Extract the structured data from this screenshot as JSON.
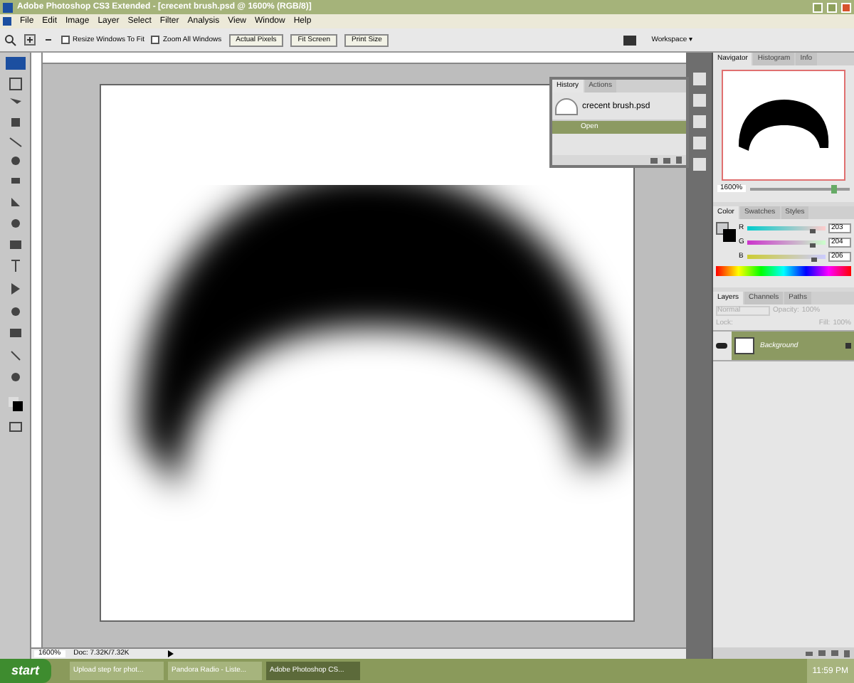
{
  "window": {
    "title": "Adobe Photoshop CS3 Extended - [crecent brush.psd @ 1600% (RGB/8)]"
  },
  "menu": [
    "File",
    "Edit",
    "Image",
    "Layer",
    "Select",
    "Filter",
    "Analysis",
    "View",
    "Window",
    "Help"
  ],
  "options_bar": {
    "checkboxes": [
      {
        "label": "Resize Windows To Fit",
        "checked": false
      },
      {
        "label": "Zoom All Windows",
        "checked": false
      }
    ],
    "buttons": [
      "Actual Pixels",
      "Fit Screen",
      "Print Size"
    ],
    "workspace": "Workspace ▾"
  },
  "history": {
    "tabs": [
      {
        "label": "History",
        "selected": true
      },
      {
        "label": "Actions",
        "selected": false
      }
    ],
    "snapshot": "crecent brush.psd",
    "items": [
      {
        "label": "Open",
        "selected": true
      }
    ]
  },
  "navigator": {
    "tabs": [
      {
        "label": "Navigator",
        "selected": true
      },
      {
        "label": "Histogram",
        "selected": false
      },
      {
        "label": "Info",
        "selected": false
      }
    ],
    "zoom": "1600%",
    "zoom_slider": {
      "level": 0.85
    }
  },
  "color": {
    "tabs": [
      {
        "label": "Color",
        "selected": true
      },
      {
        "label": "Swatches",
        "selected": false
      },
      {
        "label": "Styles",
        "selected": false
      }
    ],
    "channels": [
      {
        "name": "R",
        "level": 0.8,
        "value": "203"
      },
      {
        "name": "G",
        "level": 0.8,
        "value": "204"
      },
      {
        "name": "B",
        "level": 0.81,
        "value": "206"
      }
    ]
  },
  "layers": {
    "tabs": [
      {
        "label": "Layers",
        "selected": true
      },
      {
        "label": "Channels",
        "selected": false
      },
      {
        "label": "Paths",
        "selected": false
      }
    ],
    "blend": "Normal",
    "opacity_label": "Opacity:",
    "opacity": "100%",
    "lock_label": "Lock:",
    "fill_label": "Fill:",
    "fill": "100%",
    "items": [
      {
        "name": "Background",
        "selected": true,
        "visible": true
      }
    ]
  },
  "status_bar": {
    "zoom": "1600%",
    "doc": "Doc: 7.32K/7.32K"
  },
  "taskbar": {
    "start": "start",
    "tasks": [
      {
        "label": "Upload step for phot...",
        "selected": false
      },
      {
        "label": "Pandora Radio - Liste...",
        "selected": false
      },
      {
        "label": "Adobe Photoshop CS...",
        "selected": true
      }
    ],
    "clock": "11:59 PM"
  }
}
